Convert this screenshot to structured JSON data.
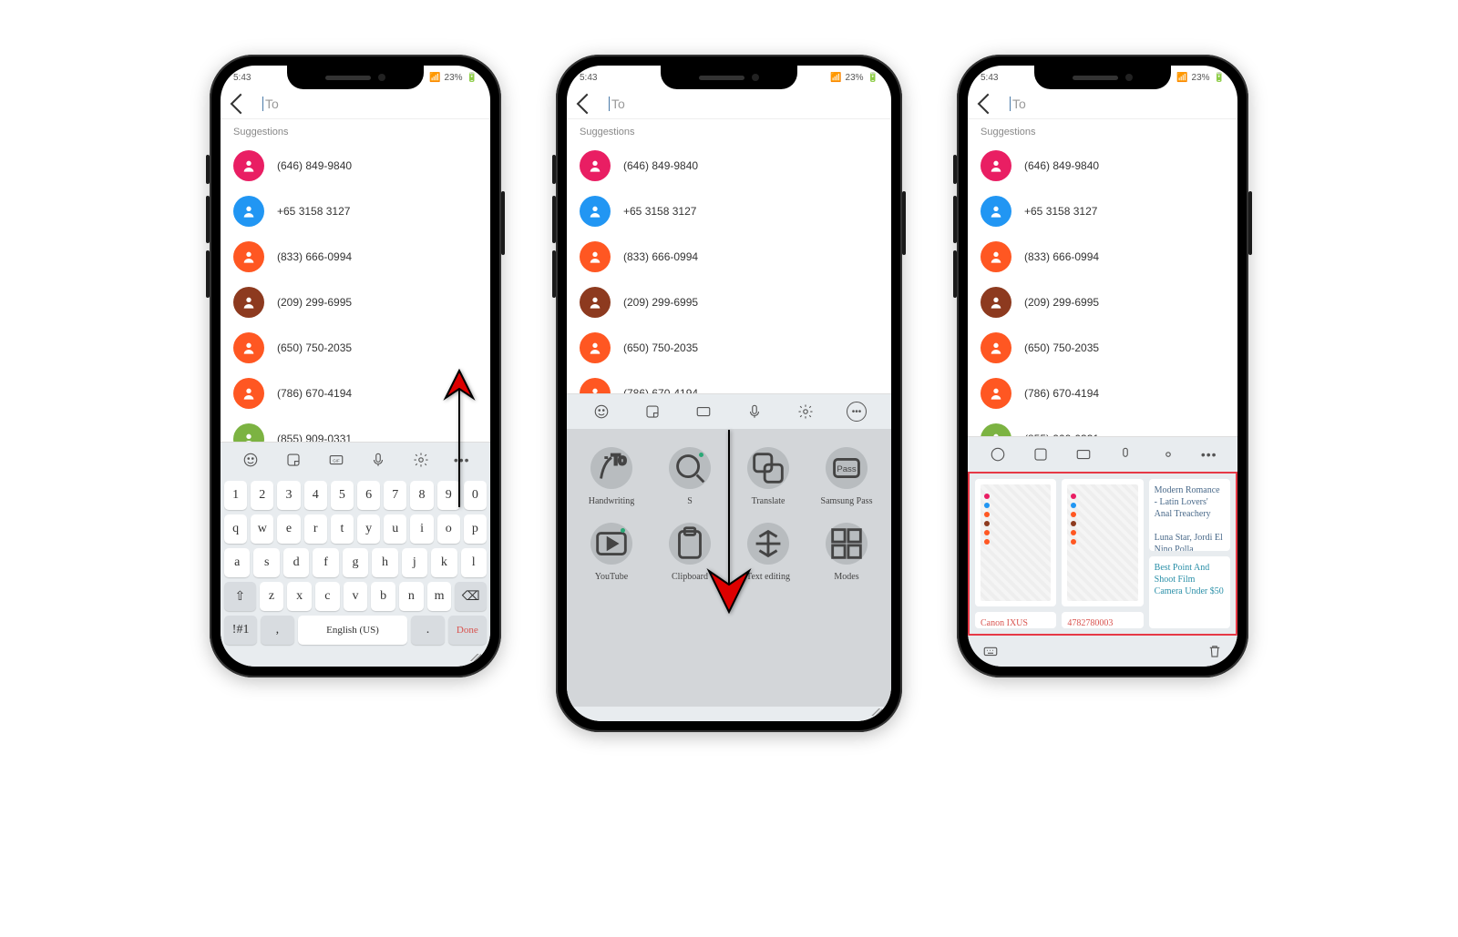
{
  "status": {
    "time": "5:43",
    "battery": "23%",
    "icons": "📷 🖼"
  },
  "app": {
    "to_label": "To",
    "suggestions_label": "Suggestions"
  },
  "contacts": [
    {
      "number": "(646) 849-9840",
      "color": "#e91e63"
    },
    {
      "number": "+65 3158 3127",
      "color": "#2196f3"
    },
    {
      "number": "(833) 666-0994",
      "color": "#ff5722"
    },
    {
      "number": "(209) 299-6995",
      "color": "#8d3a1f"
    },
    {
      "number": "(650) 750-2035",
      "color": "#ff5722"
    },
    {
      "number": "(786) 670-4194",
      "color": "#ff5722"
    },
    {
      "number": "(855) 909-0331",
      "color": "#7cb342"
    }
  ],
  "keyboard": {
    "row_num": [
      "1",
      "2",
      "3",
      "4",
      "5",
      "6",
      "7",
      "8",
      "9",
      "0"
    ],
    "row1": [
      "q",
      "w",
      "e",
      "r",
      "t",
      "y",
      "u",
      "i",
      "o",
      "p"
    ],
    "row2": [
      "a",
      "s",
      "d",
      "f",
      "g",
      "h",
      "j",
      "k",
      "l"
    ],
    "row3": [
      "z",
      "x",
      "c",
      "v",
      "b",
      "n",
      "m"
    ],
    "sym": "!#1",
    "comma": ",",
    "dot": ".",
    "space": "English (US)",
    "done": "Done"
  },
  "tools": [
    {
      "name": "Handwriting",
      "icon": "pen"
    },
    {
      "name": "S",
      "icon": "search",
      "dot": true
    },
    {
      "name": "Translate",
      "icon": "translate"
    },
    {
      "name": "Samsung Pass",
      "icon": "pass"
    },
    {
      "name": "YouTube",
      "icon": "play",
      "dot": true
    },
    {
      "name": "Clipboard",
      "icon": "clipboard"
    },
    {
      "name": "Text editing",
      "icon": "textedit"
    },
    {
      "name": "Modes",
      "icon": "modes"
    }
  ],
  "clipboard": {
    "text1": "Modern Romance - Latin Lovers' Anal Treachery",
    "text2": "Luna Star, Jordi El Nino Polla",
    "link": "Best Point And Shoot Film Camera Under $50",
    "caption1": "Canon IXUS",
    "caption2": "4782780003"
  }
}
